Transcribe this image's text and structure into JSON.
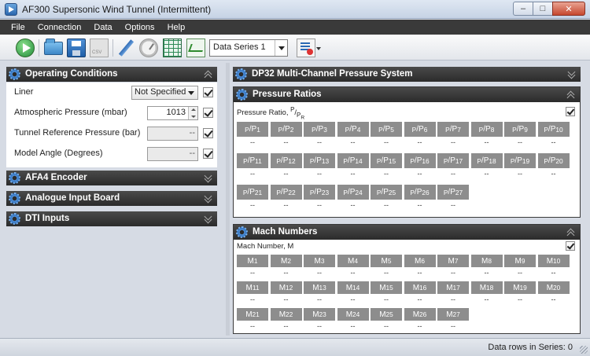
{
  "window": {
    "title": "AF300 Supersonic Wind Tunnel (Intermittent)",
    "minimize": "–",
    "maximize": "□",
    "close": "✕"
  },
  "menu": {
    "items": [
      "File",
      "Connection",
      "Data",
      "Options",
      "Help"
    ]
  },
  "toolbar": {
    "series_select": "Data Series 1"
  },
  "operating_conditions": {
    "title": "Operating Conditions",
    "rows": [
      {
        "label": "Liner",
        "value": "Not Specified"
      },
      {
        "label": "Atmospheric Pressure  (mbar)",
        "value": "1013"
      },
      {
        "label": "Tunnel Reference Pressure  (bar)",
        "value": "--"
      },
      {
        "label": "Model Angle  (Degrees)",
        "value": "--"
      }
    ]
  },
  "collapsed_panes": [
    {
      "title": "AFA4 Encoder"
    },
    {
      "title": "Analogue Input Board"
    },
    {
      "title": "DTI Inputs"
    }
  ],
  "dp32": {
    "title": "DP32 Multi-Channel Pressure System"
  },
  "pressure_ratios": {
    "title": "Pressure Ratios",
    "sub_label": "Pressure Ratio,",
    "sub_formula_p": "P",
    "sub_formula_r": "R",
    "cells": [
      {
        "p": "P",
        "n": "1",
        "v": "--"
      },
      {
        "p": "P",
        "n": "2",
        "v": "--"
      },
      {
        "p": "P",
        "n": "3",
        "v": "--"
      },
      {
        "p": "P",
        "n": "4",
        "v": "--"
      },
      {
        "p": "P",
        "n": "5",
        "v": "--"
      },
      {
        "p": "P",
        "n": "6",
        "v": "--"
      },
      {
        "p": "P",
        "n": "7",
        "v": "--"
      },
      {
        "p": "P",
        "n": "8",
        "v": "--"
      },
      {
        "p": "P",
        "n": "9",
        "v": "--"
      },
      {
        "p": "P",
        "n": "10",
        "v": "--"
      },
      {
        "p": "P",
        "n": "11",
        "v": "--"
      },
      {
        "p": "P",
        "n": "12",
        "v": "--"
      },
      {
        "p": "P",
        "n": "13",
        "v": "--"
      },
      {
        "p": "P",
        "n": "14",
        "v": "--"
      },
      {
        "p": "P",
        "n": "15",
        "v": "--"
      },
      {
        "p": "P",
        "n": "16",
        "v": "--"
      },
      {
        "p": "P",
        "n": "17",
        "v": "--"
      },
      {
        "p": "P",
        "n": "18",
        "v": "--"
      },
      {
        "p": "P",
        "n": "19",
        "v": "--"
      },
      {
        "p": "P",
        "n": "20",
        "v": "--"
      },
      {
        "p": "P",
        "n": "21",
        "v": "--"
      },
      {
        "p": "P",
        "n": "22",
        "v": "--"
      },
      {
        "p": "P",
        "n": "23",
        "v": "--"
      },
      {
        "p": "P",
        "n": "24",
        "v": "--"
      },
      {
        "p": "P",
        "n": "25",
        "v": "--"
      },
      {
        "p": "P",
        "n": "26",
        "v": "--"
      },
      {
        "p": "P",
        "n": "27",
        "v": "--"
      }
    ]
  },
  "mach_numbers": {
    "title": "Mach Numbers",
    "sub_label": "Mach Number, M",
    "cells": [
      {
        "n": "1",
        "v": "--"
      },
      {
        "n": "2",
        "v": "--"
      },
      {
        "n": "3",
        "v": "--"
      },
      {
        "n": "4",
        "v": "--"
      },
      {
        "n": "5",
        "v": "--"
      },
      {
        "n": "6",
        "v": "--"
      },
      {
        "n": "7",
        "v": "--"
      },
      {
        "n": "8",
        "v": "--"
      },
      {
        "n": "9",
        "v": "--"
      },
      {
        "n": "10",
        "v": "--"
      },
      {
        "n": "11",
        "v": "--"
      },
      {
        "n": "12",
        "v": "--"
      },
      {
        "n": "13",
        "v": "--"
      },
      {
        "n": "14",
        "v": "--"
      },
      {
        "n": "15",
        "v": "--"
      },
      {
        "n": "16",
        "v": "--"
      },
      {
        "n": "17",
        "v": "--"
      },
      {
        "n": "18",
        "v": "--"
      },
      {
        "n": "19",
        "v": "--"
      },
      {
        "n": "20",
        "v": "--"
      },
      {
        "n": "21",
        "v": "--"
      },
      {
        "n": "22",
        "v": "--"
      },
      {
        "n": "23",
        "v": "--"
      },
      {
        "n": "24",
        "v": "--"
      },
      {
        "n": "25",
        "v": "--"
      },
      {
        "n": "26",
        "v": "--"
      },
      {
        "n": "27",
        "v": "--"
      }
    ]
  },
  "status": {
    "text": "Data rows in Series: 0"
  }
}
